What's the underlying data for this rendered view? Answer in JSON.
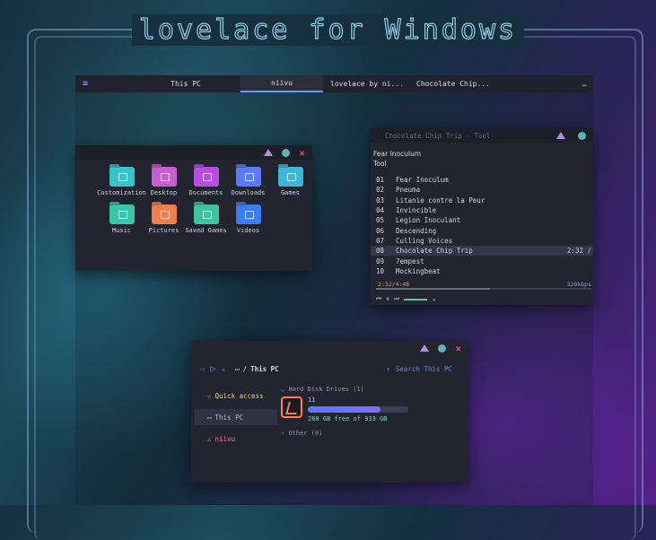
{
  "hero": {
    "title": "lovelace for Windows"
  },
  "taskbar": {
    "tabs": [
      {
        "label": "This PC",
        "active": false
      },
      {
        "label": "niivu",
        "active": true
      },
      {
        "label": "lovelace by ni...",
        "active": false
      },
      {
        "label": "Chocolate Chip...",
        "active": false
      }
    ],
    "more": "…"
  },
  "folders_window": {
    "folders": [
      {
        "label": "Customization",
        "color": "#38c2c9"
      },
      {
        "label": "Desktop",
        "color": "#c85fd0"
      },
      {
        "label": "Documents",
        "color": "#b64fe0"
      },
      {
        "label": "Downloads",
        "color": "#5a7bff"
      },
      {
        "label": "Games",
        "color": "#3fb6d6"
      },
      {
        "label": "Music",
        "color": "#39c7a9"
      },
      {
        "label": "Pictures",
        "color": "#f07e4f"
      },
      {
        "label": "Saved Games",
        "color": "#3ec2a4"
      },
      {
        "label": "Videos",
        "color": "#3b7cf0"
      }
    ]
  },
  "music_window": {
    "title": "Chocolate Chip Trip - Tool",
    "album": "Fear Inoculum",
    "artist": "Tool",
    "tracks": [
      {
        "num": "01",
        "name": "Fear Inoculum",
        "duration": "",
        "active": false
      },
      {
        "num": "02",
        "name": "Pneuma",
        "duration": "",
        "active": false
      },
      {
        "num": "03",
        "name": "Litanie contre la Peur",
        "duration": "",
        "active": false
      },
      {
        "num": "04",
        "name": "Invincible",
        "duration": "",
        "active": false
      },
      {
        "num": "05",
        "name": "Legion Inoculant",
        "duration": "",
        "active": false
      },
      {
        "num": "06",
        "name": "Descending",
        "duration": "",
        "active": false
      },
      {
        "num": "07",
        "name": "Culling Voices",
        "duration": "",
        "active": false
      },
      {
        "num": "08",
        "name": "Chocolate Chip Trip",
        "duration": "2:32 /",
        "active": true
      },
      {
        "num": "09",
        "name": "7empest",
        "duration": "",
        "active": false
      },
      {
        "num": "10",
        "name": "Mockingbeat",
        "duration": "",
        "active": false
      }
    ],
    "time": "2:32/4:48",
    "bitrate": "320kbps",
    "progress": 0.53
  },
  "explorer_window": {
    "path": "This PC",
    "search_placeholder": "Search This PC",
    "sidebar": [
      {
        "label": "Quick access",
        "icon": "star-icon",
        "color": "#e5d36a",
        "active": false
      },
      {
        "label": "This PC",
        "icon": "monitor-icon",
        "color": "#b9bed3",
        "active": true
      },
      {
        "label": "niivu",
        "icon": "user-icon",
        "color": "#ff6fb0",
        "active": false
      }
    ],
    "section_drives": "Hard Disk Drives (1)",
    "drive": {
      "name": "11",
      "free_text": "260 GB free of 933 GB",
      "used_fraction": 0.72
    },
    "section_other": "Other (0)"
  }
}
